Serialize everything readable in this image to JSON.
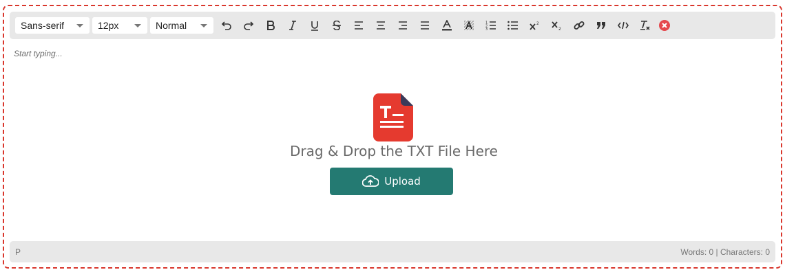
{
  "toolbar": {
    "font_family": "Sans-serif",
    "font_size": "12px",
    "format": "Normal",
    "buttons": [
      "undo",
      "redo",
      "bold",
      "italic",
      "underline",
      "strikethrough",
      "align-left",
      "align-center",
      "align-right",
      "justify",
      "text-color",
      "highlight-color",
      "ordered-list",
      "bullet-list",
      "superscript",
      "subscript",
      "link",
      "blockquote",
      "code",
      "clear-formatting",
      "close"
    ]
  },
  "editor": {
    "placeholder": "Start typing..."
  },
  "dropzone": {
    "text": "Drag & Drop the TXT File Here",
    "upload_label": "Upload",
    "file_icon": "txt-file-icon"
  },
  "status": {
    "path": "P",
    "counts": "Words: 0 | Characters: 0"
  },
  "colors": {
    "accent": "#247a72",
    "border": "#d9362c",
    "close": "#e5484d",
    "file_icon": "#e53a2f"
  }
}
